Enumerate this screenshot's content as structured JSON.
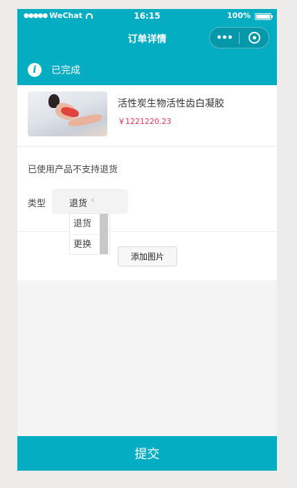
{
  "status_bar": {
    "signal": "●●●●●",
    "carrier": "WeChat",
    "time": "16:15",
    "battery": "100%"
  },
  "nav": {
    "title": "订单详情",
    "more_icon": "•••",
    "close_icon": "record-circle-icon"
  },
  "order": {
    "status": "已完成",
    "status_icon": "i"
  },
  "product": {
    "name": "活性炭生物活性齿白凝胶",
    "price": "￥1221220.23"
  },
  "form": {
    "notice": "已使用产品不支持退货",
    "type_label": "类型",
    "type_value": "退货",
    "chevron": "‹",
    "options": [
      "退货",
      "更换"
    ],
    "add_image_label": "添加图片"
  },
  "footer": {
    "submit_label": "提交"
  },
  "colors": {
    "primary": "#05adc2",
    "price": "#e0314b",
    "page_bg": "#f4f4f4"
  }
}
